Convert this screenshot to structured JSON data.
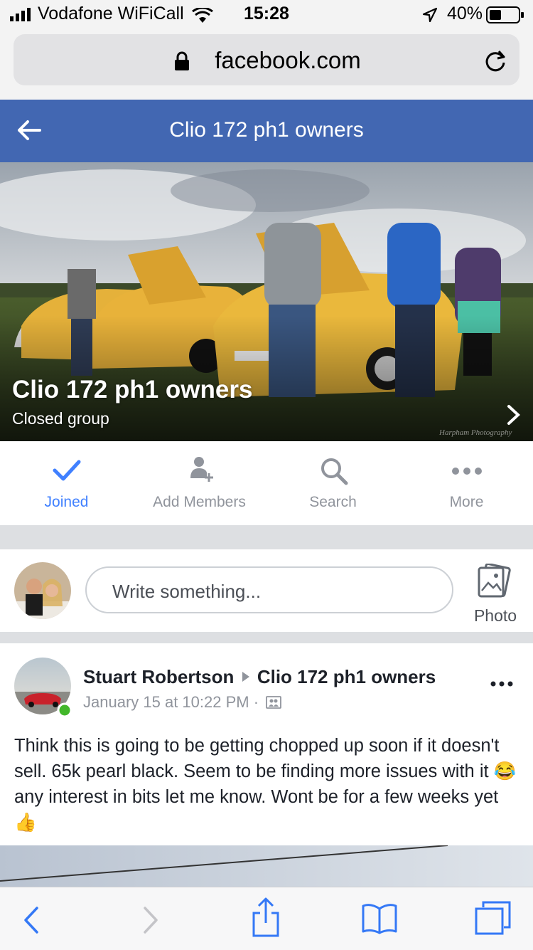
{
  "status_bar": {
    "carrier": "Vodafone WiFiCall",
    "time": "15:28",
    "battery": "40%"
  },
  "browser": {
    "url": "facebook.com",
    "icons": [
      "lock-icon",
      "reload-icon"
    ]
  },
  "header": {
    "title": "Clio 172 ph1 owners",
    "back_icon": "back-arrow-icon"
  },
  "cover": {
    "name": "Clio 172 ph1 owners",
    "type": "Closed group",
    "watermark": "Harpham Photography"
  },
  "actions": [
    {
      "label": "Joined",
      "icon": "checkmark-icon"
    },
    {
      "label": "Add Members",
      "icon": "add-person-icon"
    },
    {
      "label": "Search",
      "icon": "search-icon"
    },
    {
      "label": "More",
      "icon": "more-icon"
    }
  ],
  "composer": {
    "placeholder": "Write something...",
    "photo_label": "Photo"
  },
  "post": {
    "author": "Stuart Robertson",
    "group": "Clio 172 ph1 owners",
    "date": "January 15 at 10:22 PM ·",
    "text": "Think this is going to be getting chopped up soon if it doesn't sell. 65k pearl black. Seem to be finding more issues with it 😂 any interest in bits let me know. Wont be for a few weeks yet 👍"
  },
  "colors": {
    "fb_blue": "#4267b2",
    "link_blue": "#4080ff",
    "grey_text": "#90949c"
  }
}
